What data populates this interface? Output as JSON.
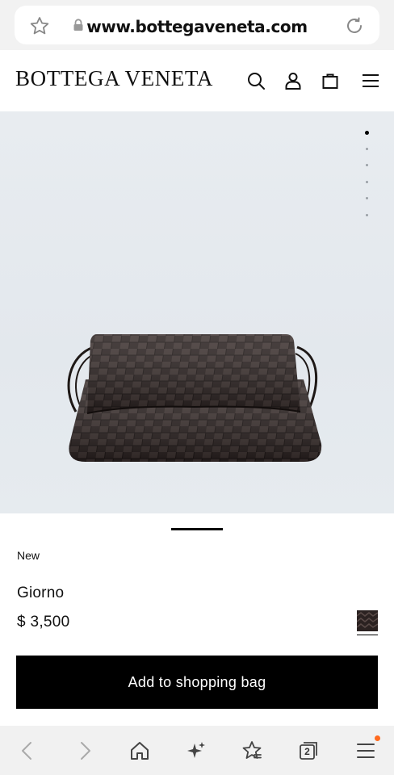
{
  "browser": {
    "url": "www.bottegaveneta.com",
    "tab_count": "2"
  },
  "header": {
    "logo": "BOTTEGA VENETA"
  },
  "gallery": {
    "image_count": 6,
    "current_image": 1
  },
  "product": {
    "badge": "New",
    "name": "Giorno",
    "price": "$ 3,500",
    "add_to_bag_label": "Add to shopping bag"
  },
  "colors": {
    "accent": "#000000",
    "notification": "#ff6a1f",
    "hero_background": "#e5eaef"
  },
  "icons": {
    "url_bar": [
      "star-icon",
      "lock-icon",
      "reload-icon"
    ],
    "header": [
      "search-icon",
      "account-icon",
      "shopping-bag-icon",
      "menu-icon"
    ],
    "toolbar": [
      "back-icon",
      "forward-icon",
      "home-icon",
      "sparkle-icon",
      "favorites-icon",
      "tabs-icon",
      "menu-icon"
    ]
  }
}
